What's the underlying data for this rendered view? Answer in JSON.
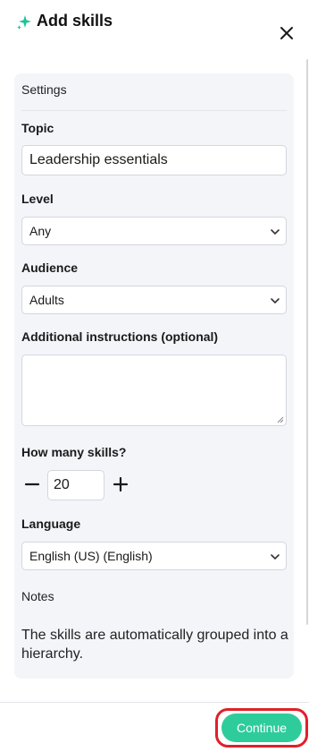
{
  "header": {
    "title": "Add skills",
    "icon": "sparkle-icon",
    "accent_color": "#1fc29a"
  },
  "settings": {
    "section_title": "Settings",
    "topic": {
      "label": "Topic",
      "value": "Leadership essentials"
    },
    "level": {
      "label": "Level",
      "value": "Any"
    },
    "audience": {
      "label": "Audience",
      "value": "Adults"
    },
    "instructions": {
      "label": "Additional instructions (optional)",
      "value": ""
    },
    "count": {
      "label": "How many skills?",
      "value": "20"
    },
    "language": {
      "label": "Language",
      "value": "English (US) (English)"
    }
  },
  "notes": {
    "title": "Notes",
    "text": "The skills are automatically grouped into a hierarchy."
  },
  "footer": {
    "continue_label": "Continue",
    "continue_color": "#2ecc9b",
    "highlight_color": "#e0202a"
  }
}
